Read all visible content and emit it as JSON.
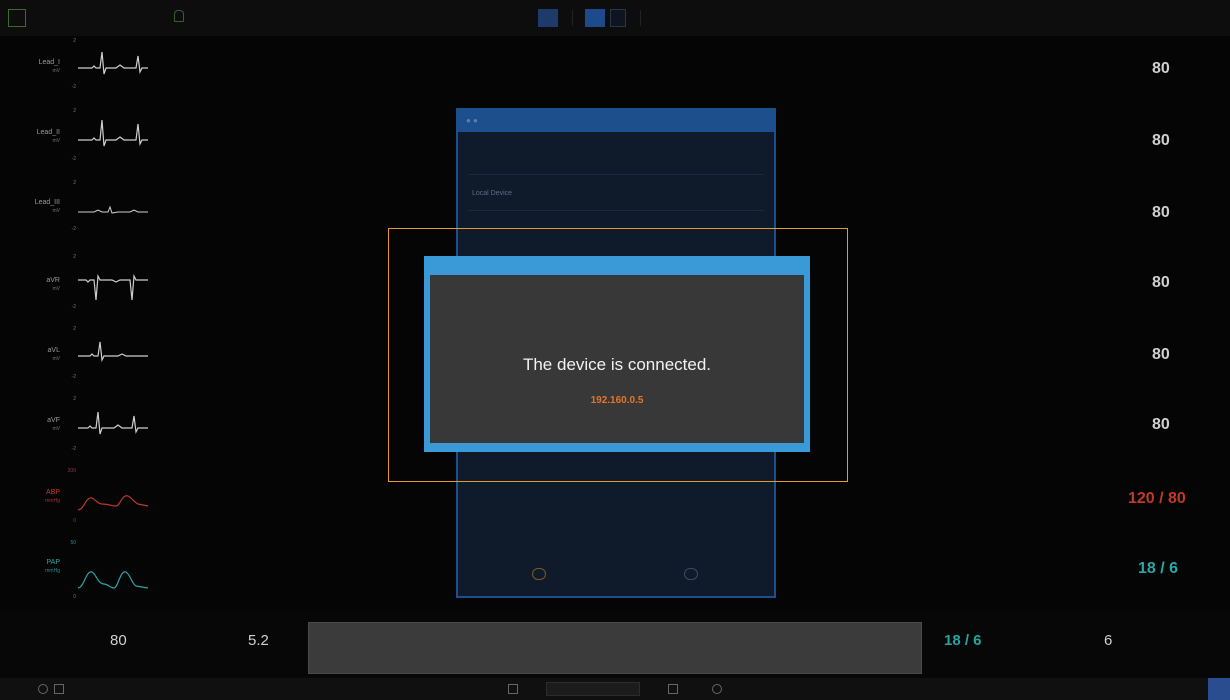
{
  "topbar": {
    "device_lines": [
      "",
      ""
    ],
    "hr_readout": "",
    "patient_name": "",
    "right_label": ""
  },
  "leads": [
    {
      "name": "Lead_I",
      "unit": "mV"
    },
    {
      "name": "Lead_II",
      "unit": "mV"
    },
    {
      "name": "Lead_III",
      "unit": "mV"
    },
    {
      "name": "aVR",
      "unit": "mV"
    },
    {
      "name": "aVL",
      "unit": "mV"
    },
    {
      "name": "aVF",
      "unit": "mV"
    },
    {
      "name": "ABP",
      "unit": "mmHg"
    },
    {
      "name": "PAP",
      "unit": "mmHg"
    }
  ],
  "right_values": [
    "80",
    "80",
    "80",
    "80",
    "80",
    "80",
    "120 / 80",
    "18 / 6"
  ],
  "colors": {
    "accent": "#3a9ad8",
    "highlight": "#e69a2b",
    "abp": "#c0392b",
    "pap": "#2aa7a6",
    "ip": "#e0772a",
    "green": "#61c23b"
  },
  "background_window": {
    "title": "",
    "rows": [
      {
        "label": "",
        "value": ""
      },
      {
        "label": "Local Device",
        "value": ""
      },
      {
        "label": "",
        "value": ""
      }
    ]
  },
  "dialog": {
    "message": "The device is connected.",
    "ip": "192.160.0.5"
  },
  "bottom": {
    "hr_value": "80",
    "resp_value": "5.2",
    "pap_value": "18 / 6",
    "right_value": "6",
    "notice_line1": "",
    "notice_line2": ""
  }
}
